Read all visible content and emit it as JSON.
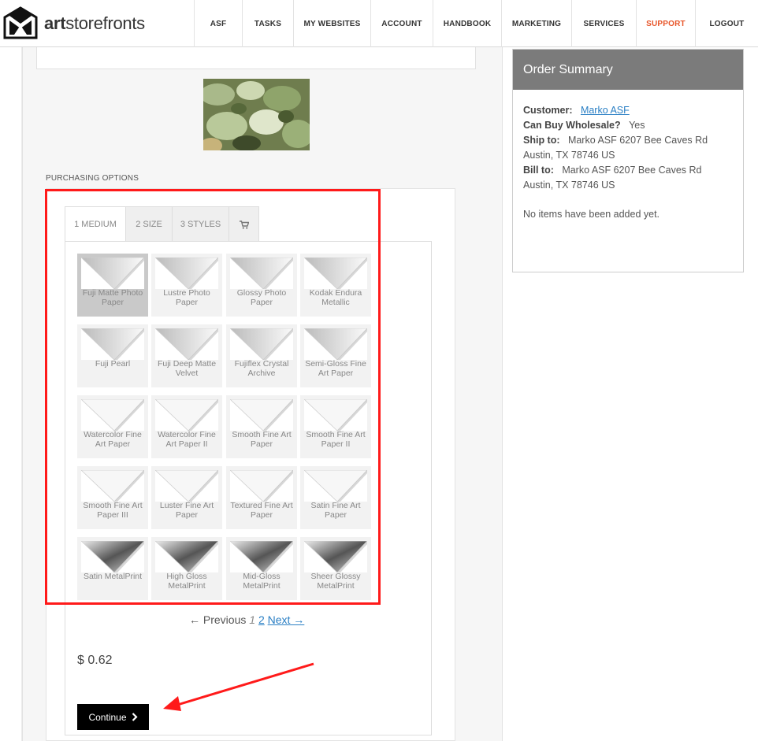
{
  "brand": {
    "name_bold": "art",
    "name_rest": "storefronts"
  },
  "nav": [
    {
      "label": "ASF"
    },
    {
      "label": "TASKS"
    },
    {
      "label": "MY WEBSITES"
    },
    {
      "label": "ACCOUNT"
    },
    {
      "label": "HANDBOOK"
    },
    {
      "label": "MARKETING"
    },
    {
      "label": "SERVICES"
    },
    {
      "label": "SUPPORT"
    },
    {
      "label": "LOGOUT"
    }
  ],
  "colors": {
    "support": "#e8562a",
    "annotation": "#ff1a1a"
  },
  "purchasing": {
    "section_label": "PURCHASING OPTIONS",
    "tabs": [
      {
        "label": "1 MEDIUM"
      },
      {
        "label": "2 SIZE"
      },
      {
        "label": "3 STYLES"
      },
      {
        "icon": "cart-icon"
      }
    ],
    "media": [
      {
        "label": "Fuji Matte Photo Paper",
        "selected": true
      },
      {
        "label": "Lustre Photo Paper"
      },
      {
        "label": "Glossy Photo Paper"
      },
      {
        "label": "Kodak Endura Metallic"
      },
      {
        "label": "Fuji Pearl"
      },
      {
        "label": "Fuji Deep Matte Velvet"
      },
      {
        "label": "Fujiflex Crystal Archive"
      },
      {
        "label": "Semi-Gloss Fine Art Paper"
      },
      {
        "label": "Watercolor Fine Art Paper"
      },
      {
        "label": "Watercolor Fine Art Paper II"
      },
      {
        "label": "Smooth Fine Art Paper"
      },
      {
        "label": "Smooth Fine Art Paper II"
      },
      {
        "label": "Smooth Fine Art Paper III"
      },
      {
        "label": "Luster Fine Art Paper"
      },
      {
        "label": "Textured Fine Art Paper"
      },
      {
        "label": "Satin Fine Art Paper"
      },
      {
        "label": "Satin MetalPrint"
      },
      {
        "label": "High Gloss MetalPrint"
      },
      {
        "label": "Mid-Gloss MetalPrint"
      },
      {
        "label": "Sheer Glossy MetalPrint"
      }
    ],
    "pager": {
      "prev": "← Previous",
      "current": "1",
      "page2": "2",
      "next": "Next →"
    },
    "price": "$ 0.62",
    "continue_label": "Continue"
  },
  "order_summary": {
    "title": "Order Summary",
    "customer_label": "Customer:",
    "customer_name": "Marko ASF",
    "wholesale_label": "Can Buy Wholesale?",
    "wholesale_value": "Yes",
    "ship_label": "Ship to:",
    "ship_value": "Marko ASF 6207 Bee Caves Rd Austin, TX 78746 US",
    "bill_label": "Bill to:",
    "bill_value": "Marko ASF 6207 Bee Caves Rd Austin, TX 78746 US",
    "empty_text": "No items have been added yet."
  }
}
